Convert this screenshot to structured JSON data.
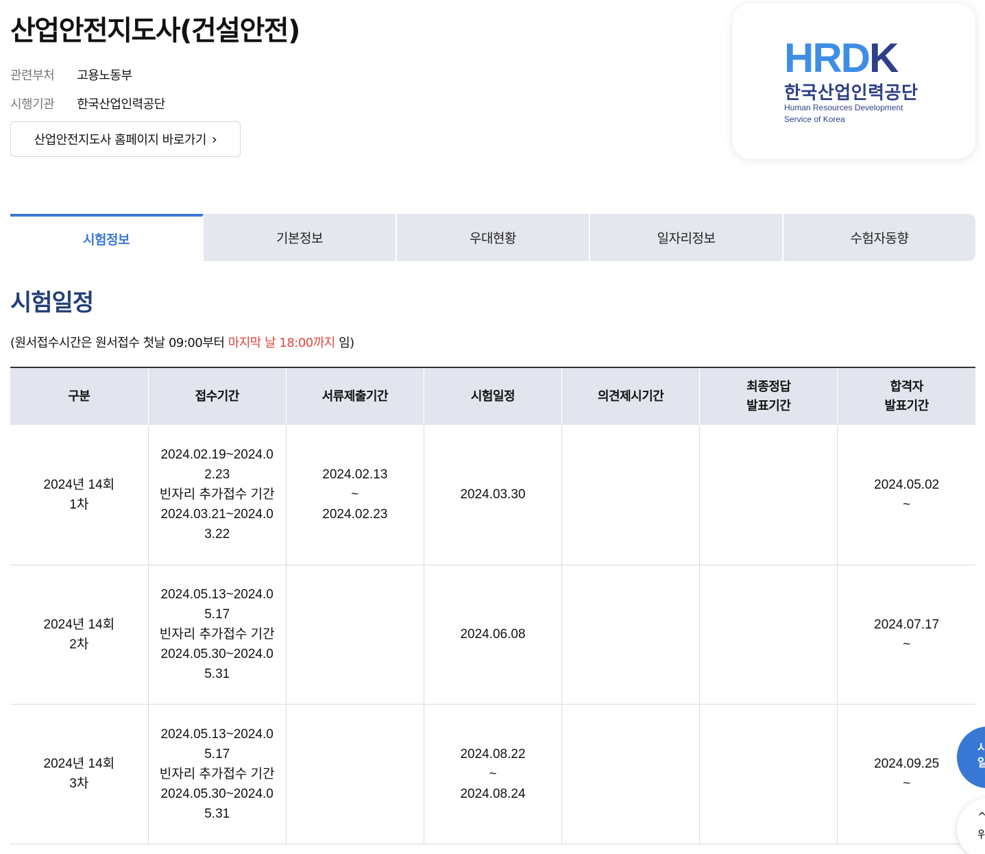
{
  "header": {
    "title": "산업안전지도사(건설안전)",
    "ministry_label": "관련부처",
    "ministry_value": "고용노동부",
    "agency_label": "시행기관",
    "agency_value": "한국산업인력공단",
    "homepage_button": "산업안전지도사 홈페이지 바로가기",
    "chevron": "›"
  },
  "logo": {
    "mark_part1": "HRD",
    "mark_part2": "K",
    "korean": "한국산업인력공단",
    "english_line1": "Human Resources Development",
    "english_line2": "Service of Korea"
  },
  "tabs": [
    {
      "label": "시험정보",
      "active": true
    },
    {
      "label": "기본정보",
      "active": false
    },
    {
      "label": "우대현황",
      "active": false
    },
    {
      "label": "일자리정보",
      "active": false
    },
    {
      "label": "수험자동향",
      "active": false
    }
  ],
  "section": {
    "title": "시험일정",
    "note_prefix": "(원서접수시간은 원서접수 첫날 09:00부터 ",
    "note_red": "마지막 날 18:00까지",
    "note_suffix": " 임)"
  },
  "table": {
    "headers": [
      "구분",
      "접수기간",
      "서류제출기간",
      "시험일정",
      "의견제시기간",
      "최종정답\n발표기간",
      "합격자\n발표기간"
    ],
    "rows": [
      {
        "division": "2024년 14회\n1차",
        "application": "2024.02.19~2024.02.23\n빈자리 추가접수 기간\n2024.03.21~2024.03.22",
        "documents": "2024.02.13\n~\n2024.02.23",
        "exam": "2024.03.30",
        "opinion": "",
        "final_answer": "",
        "result": "2024.05.02\n~"
      },
      {
        "division": "2024년 14회\n2차",
        "application": "2024.05.13~2024.05.17\n빈자리 추가접수 기간\n2024.05.30~2024.05.31",
        "documents": "",
        "exam": "2024.06.08",
        "opinion": "",
        "final_answer": "",
        "result": "2024.07.17\n~"
      },
      {
        "division": "2024년 14회\n3차",
        "application": "2024.05.13~2024.05.17\n빈자리 추가접수 기간\n2024.05.30~2024.05.31",
        "documents": "",
        "exam": "2024.08.22\n~\n2024.08.24",
        "opinion": "",
        "final_answer": "",
        "result": "2024.09.25\n~"
      }
    ]
  },
  "floating": {
    "schedule_btn": "시\n일",
    "top_btn": "^\n위"
  }
}
